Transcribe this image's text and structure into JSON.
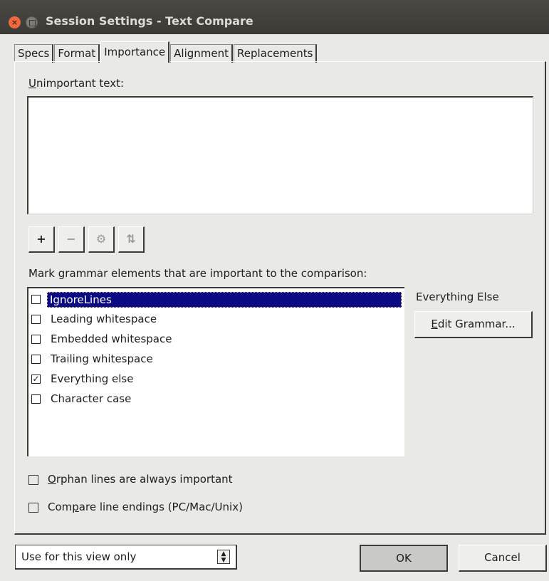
{
  "window": {
    "title": "Session Settings - Text Compare"
  },
  "tabs": [
    {
      "label": "Specs"
    },
    {
      "label": "Format"
    },
    {
      "label": "Importance"
    },
    {
      "label": "Alignment"
    },
    {
      "label": "Replacements"
    }
  ],
  "unimportant": {
    "label_mnemonic": "U",
    "label_rest": "nimportant text:",
    "value": "",
    "toolbar": {
      "add": "+",
      "remove": "−",
      "settings": "⚙",
      "sort": "⇅"
    }
  },
  "grammar": {
    "label_pre": "Mark ",
    "label_mnemonic": "g",
    "label_rest": "rammar elements that are important to the comparison:",
    "items": [
      {
        "label": "IgnoreLines",
        "checked": false,
        "mark": "",
        "selected": true
      },
      {
        "label": "Leading whitespace",
        "checked": false,
        "mark": ""
      },
      {
        "label": "Embedded whitespace",
        "checked": false,
        "mark": ""
      },
      {
        "label": "Trailing whitespace",
        "checked": false,
        "mark": ""
      },
      {
        "label": "Everything else",
        "checked": true,
        "mark": "✓"
      },
      {
        "label": "Character case",
        "checked": false,
        "mark": ""
      }
    ],
    "selected_name": "Everything Else",
    "edit_button_mnemonic": "E",
    "edit_button_rest": "dit Grammar..."
  },
  "options": {
    "orphan_mnemonic": "O",
    "orphan_rest": "rphan lines are always important",
    "orphan_checked": false,
    "line_endings_pre": "Com",
    "line_endings_mnemonic": "p",
    "line_endings_rest": "are line endings (PC/Mac/Unix)",
    "line_endings_checked": false
  },
  "footer": {
    "scope_value": "Use for this view only",
    "ok_label": "OK",
    "cancel_label": "Cancel"
  },
  "colors": {
    "selection": "#0a0a84",
    "title_bar": "#3b3a36",
    "close_button": "#f0683f"
  }
}
